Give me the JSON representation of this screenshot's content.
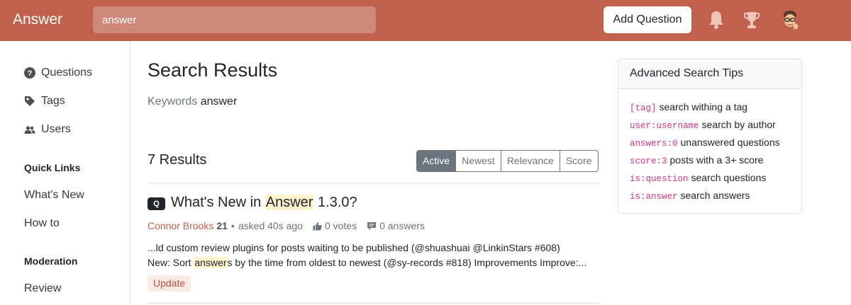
{
  "header": {
    "brand": "Answer",
    "search_value": "answer",
    "add_question_label": "Add Question"
  },
  "sidebar": {
    "nav": [
      {
        "label": "Questions",
        "icon": "question-circle-icon"
      },
      {
        "label": "Tags",
        "icon": "tag-icon"
      },
      {
        "label": "Users",
        "icon": "users-icon"
      }
    ],
    "quick_links_heading": "Quick Links",
    "quick_links": [
      "What's New",
      "How to"
    ],
    "moderation_heading": "Moderation",
    "moderation_links": [
      "Review"
    ]
  },
  "main": {
    "title": "Search Results",
    "keywords_label": "Keywords",
    "keywords_value": "answer",
    "results_count": "7 Results",
    "sort_tabs": [
      "Active",
      "Newest",
      "Relevance",
      "Score"
    ],
    "active_sort": "Active"
  },
  "result": {
    "badge": "Q",
    "title_before": "What's New in ",
    "title_highlight": "Answer",
    "title_after": " 1.3.0?",
    "author": "Connor Brooks",
    "reputation": "21",
    "separator": "•",
    "asked": "asked 40s ago",
    "votes": "0 votes",
    "answers": "0 answers",
    "excerpt_line1": "...ld custom review plugins for posts waiting to be published (@shuashuai @LinkinStars #608)",
    "excerpt_line2_before": "New: Sort ",
    "excerpt_line2_highlight": "answer",
    "excerpt_line2_after": "s by the time from oldest to newest (@sy-records #818) Improvements Improve:...",
    "tag": "Update"
  },
  "tips": {
    "heading": "Advanced Search Tips",
    "items": [
      {
        "code": "[tag]",
        "text": "search withing a tag"
      },
      {
        "code": "user:username",
        "text": "search by author"
      },
      {
        "code": "answers:0",
        "text": "unanswered questions"
      },
      {
        "code": "score:3",
        "text": "posts with a 3+ score"
      },
      {
        "code": "is:question",
        "text": "search questions"
      },
      {
        "code": "is:answer",
        "text": "search answers"
      }
    ]
  },
  "colors": {
    "brand": "#c0614d",
    "highlight": "#fff3cd",
    "code": "#d63384",
    "tag_bg": "#fbe9e5"
  }
}
